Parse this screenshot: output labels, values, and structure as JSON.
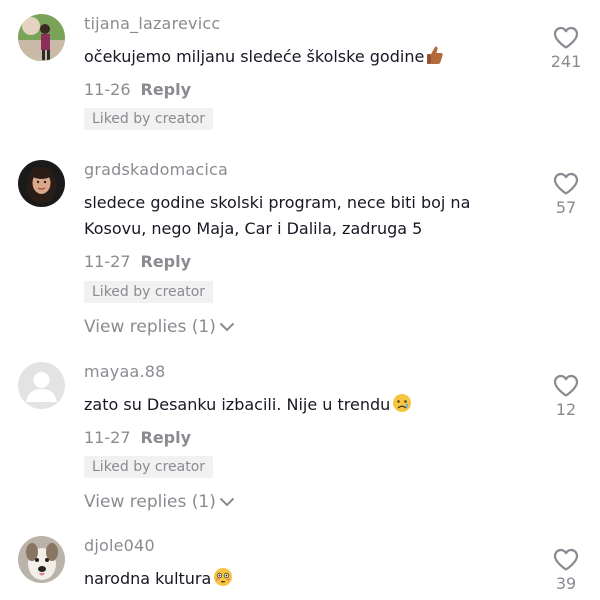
{
  "comments": [
    {
      "username": "tijana_lazarevicc",
      "text": "očekujemo miljanu sledeće školske godine",
      "emoji": "thumbs-up-icon",
      "date": "11-26",
      "reply_label": "Reply",
      "liked_badge": "Liked by creator",
      "view_replies": "",
      "likes": "241"
    },
    {
      "username": "gradskadomacica",
      "text": "sledece godine skolski program, nece biti boj na\nKosovu, nego Maja, Car i Dalila, zadruga 5",
      "emoji": "",
      "date": "11-27",
      "reply_label": "Reply",
      "liked_badge": "Liked by creator",
      "view_replies": "View replies (1)",
      "likes": "57"
    },
    {
      "username": "mayaa.88",
      "text": "zato su Desanku izbacili. Nije u trendu",
      "emoji": "sad-face-icon",
      "date": "11-27",
      "reply_label": "Reply",
      "liked_badge": "Liked by creator",
      "view_replies": "View replies (1)",
      "likes": "12"
    },
    {
      "username": "djole040",
      "text": "narodna kultura",
      "emoji": "flushed-face-icon",
      "date": "",
      "reply_label": "",
      "liked_badge": "",
      "view_replies": "",
      "likes": "39"
    }
  ],
  "colors": {
    "text": "#161823",
    "muted": "#8a8b91",
    "badge_bg": "#f1f1f2"
  }
}
